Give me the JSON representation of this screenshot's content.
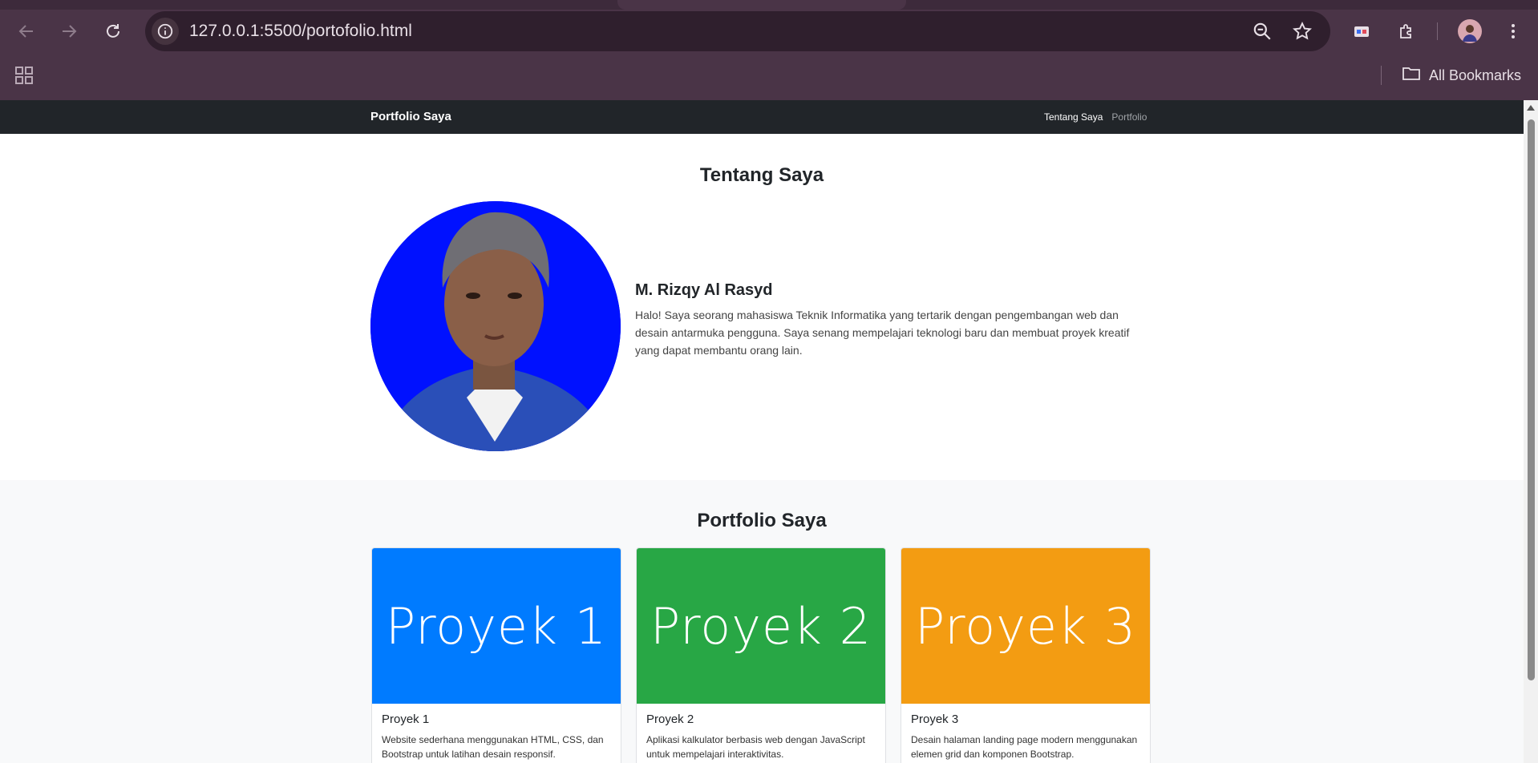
{
  "browser": {
    "url": "127.0.0.1:5500/portofolio.html",
    "bookmarks_label": "All Bookmarks"
  },
  "site": {
    "brand": "Portfolio Saya",
    "nav": [
      {
        "label": "Tentang Saya"
      },
      {
        "label": "Portfolio"
      }
    ]
  },
  "about": {
    "title": "Tentang Saya",
    "name": "M. Rizqy Al Rasyd",
    "description": "Halo! Saya seorang mahasiswa Teknik Informatika yang tertarik dengan pengembangan web dan desain antarmuka pengguna. Saya senang mempelajari teknologi baru dan membuat proyek kreatif yang dapat membantu orang lain."
  },
  "portfolio": {
    "title": "Portfolio Saya",
    "projects": [
      {
        "image_text": "Proyek 1",
        "title": "Proyek 1",
        "description": "Website sederhana menggunakan HTML, CSS, dan Bootstrap untuk latihan desain responsif.",
        "color": "#007bff"
      },
      {
        "image_text": "Proyek 2",
        "title": "Proyek 2",
        "description": "Aplikasi kalkulator berbasis web dengan JavaScript untuk mempelajari interaktivitas.",
        "color": "#28a745"
      },
      {
        "image_text": "Proyek 3",
        "title": "Proyek 3",
        "description": "Desain halaman landing page modern menggunakan elemen grid dan komponen Bootstrap.",
        "color": "#f39c12"
      }
    ]
  },
  "colors": {
    "chrome_bg": "#4a3447",
    "navbar_bg": "#212529",
    "photo_bg": "#0011ff"
  }
}
